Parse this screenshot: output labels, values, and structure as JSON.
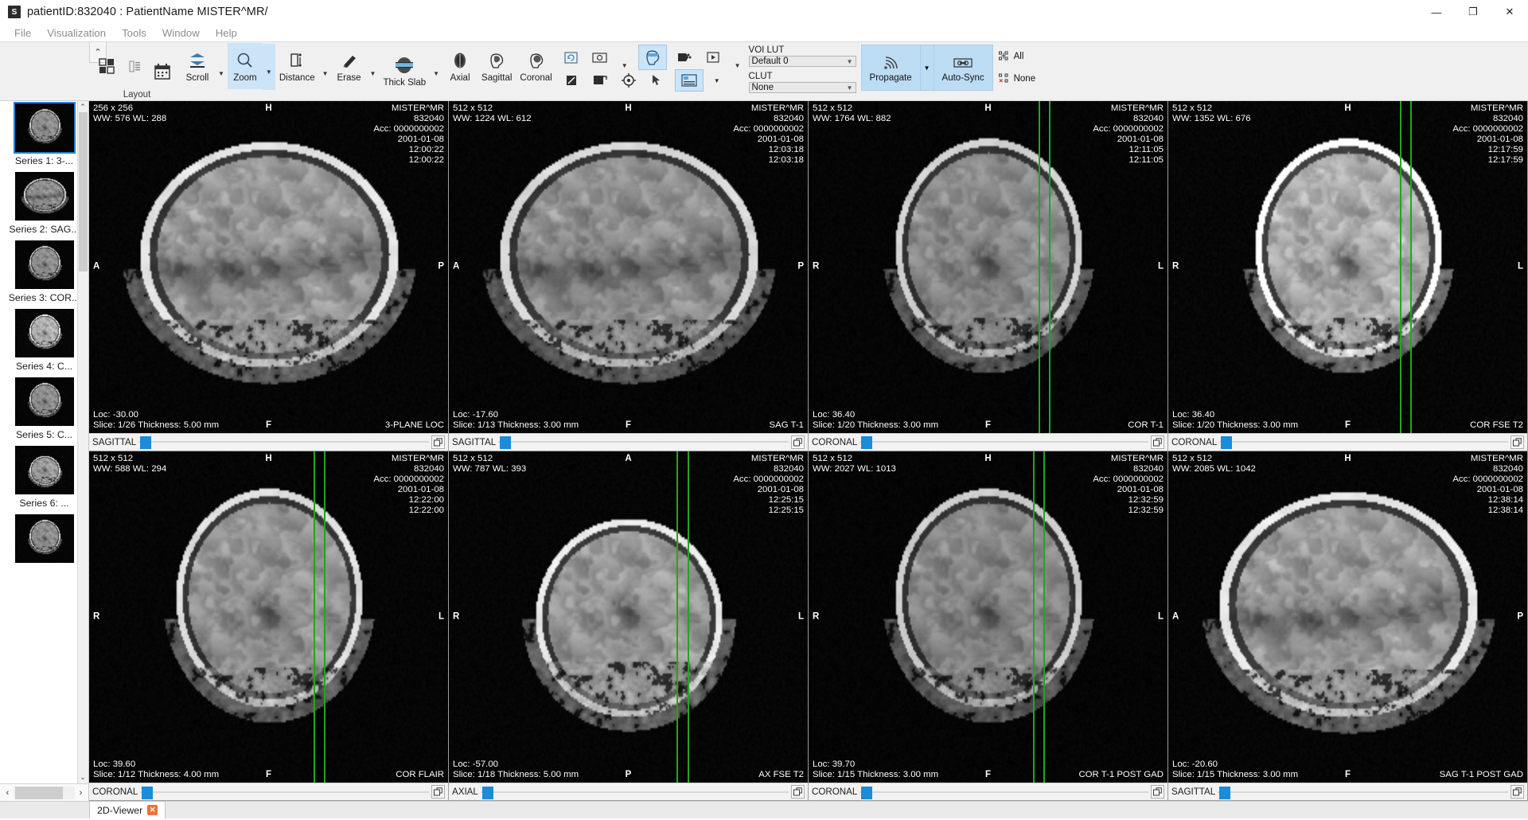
{
  "window": {
    "title": "patientID:832040 : PatientName MISTER^MR/",
    "app_icon": "S",
    "minimize": "—",
    "maximize": "❐",
    "close": "✕"
  },
  "menu": {
    "items": [
      "File",
      "Visualization",
      "Tools",
      "Window",
      "Help"
    ]
  },
  "ribbon": {
    "collapse_icon": "⌃",
    "layout_label": "Layout",
    "buttons": [
      {
        "name": "layout-grid",
        "label": "",
        "icon": "layout-grid-icon"
      },
      {
        "name": "layout-list",
        "label": "",
        "icon": "layout-list-icon"
      },
      {
        "name": "layout-calendar",
        "label": "",
        "icon": "calendar-icon"
      },
      {
        "name": "scroll",
        "label": "Scroll",
        "icon": "scroll-icon"
      },
      {
        "name": "zoom",
        "label": "Zoom",
        "icon": "magnifier-icon",
        "active": true
      },
      {
        "name": "distance",
        "label": "Distance",
        "icon": "distance-icon"
      },
      {
        "name": "erase",
        "label": "Erase",
        "icon": "eraser-icon"
      },
      {
        "name": "thick-slab",
        "label": "Thick Slab",
        "icon": "thick-slab-icon"
      },
      {
        "name": "axial",
        "label": "Axial",
        "icon": "axial-head-icon"
      },
      {
        "name": "sagittal",
        "label": "Sagittal",
        "icon": "sagittal-head-icon"
      },
      {
        "name": "coronal",
        "label": "Coronal",
        "icon": "coronal-head-icon"
      }
    ],
    "voi_lut": {
      "label": "VOI LUT",
      "value": "Default 0"
    },
    "clut": {
      "label": "CLUT",
      "value": "None"
    },
    "propagate": {
      "label": "Propagate",
      "icon": "broadcast-icon"
    },
    "auto_sync": {
      "label": "Auto-Sync",
      "icon": "link-icon"
    },
    "sync_all": {
      "label": "All",
      "icon": "sync-all-icon"
    },
    "sync_none": {
      "label": "None",
      "icon": "sync-none-icon"
    }
  },
  "sidebar": {
    "scroll_up": "⌃",
    "scroll_down": "⌄",
    "left_arrow": "‹",
    "right_arrow": "›",
    "series": [
      {
        "label": "Series 1: 3-...",
        "thumb": "coronal-brain"
      },
      {
        "label": "Series 2: SAG...",
        "thumb": "sagittal-brain"
      },
      {
        "label": "Series 3: COR...",
        "thumb": "coronal-brain"
      },
      {
        "label": "Series 4: C...",
        "thumb": "coronal-bright"
      },
      {
        "label": "Series 5: C...",
        "thumb": "coronal-brain"
      },
      {
        "label": "Series 6: ...",
        "thumb": "axial-skull"
      },
      {
        "label": "",
        "thumb": "coronal-brain"
      }
    ]
  },
  "viewports": [
    {
      "matrix": "256 x 256",
      "window": "WW: 576 WL: 288",
      "patient_name": "MISTER^MR",
      "patient_id": "832040",
      "accession": "Acc: 0000000002",
      "date": "2001-01-08",
      "time1": "12:00:22",
      "time2": "12:00:22",
      "loc": "Loc: -30.00",
      "slice": "Slice: 1/26 Thickness: 5.00 mm",
      "series_desc": "3-PLANE LOC",
      "orient_top": "H",
      "orient_bottom": "F",
      "orient_left": "A",
      "orient_right": "P",
      "bar_orient": "SAGITTAL",
      "slider_pos": 2,
      "reflines": [],
      "render": "sagittal-head"
    },
    {
      "matrix": "512 x 512",
      "window": "WW: 1224 WL: 612",
      "patient_name": "MISTER^MR",
      "patient_id": "832040",
      "accession": "Acc: 0000000002",
      "date": "2001-01-08",
      "time1": "12:03:18",
      "time2": "12:03:18",
      "loc": "Loc: -17.60",
      "slice": "Slice: 1/13 Thickness: 3.00 mm",
      "series_desc": "SAG T-1",
      "orient_top": "H",
      "orient_bottom": "F",
      "orient_left": "A",
      "orient_right": "P",
      "bar_orient": "SAGITTAL",
      "slider_pos": 2,
      "reflines": [],
      "render": "sagittal-head2"
    },
    {
      "matrix": "512 x 512",
      "window": "WW: 1764 WL: 882",
      "patient_name": "MISTER^MR",
      "patient_id": "832040",
      "accession": "Acc: 0000000002",
      "date": "2001-01-08",
      "time1": "12:11:05",
      "time2": "12:11:05",
      "loc": "Loc: 36.40",
      "slice": "Slice: 1/20 Thickness: 3.00 mm",
      "series_desc": "COR T-1",
      "orient_top": "H",
      "orient_bottom": "F",
      "orient_left": "R",
      "orient_right": "L",
      "bar_orient": "CORONAL",
      "slider_pos": 2,
      "reflines": [
        0.64,
        0.67
      ],
      "render": "coronal-head"
    },
    {
      "matrix": "512 x 512",
      "window": "WW: 1352 WL: 676",
      "patient_name": "MISTER^MR",
      "patient_id": "832040",
      "accession": "Acc: 0000000002",
      "date": "2001-01-08",
      "time1": "12:17:59",
      "time2": "12:17:59",
      "loc": "Loc: 36.40",
      "slice": "Slice: 1/20 Thickness: 3.00 mm",
      "series_desc": "COR FSE T2",
      "orient_top": "H",
      "orient_bottom": "F",
      "orient_left": "R",
      "orient_right": "L",
      "bar_orient": "CORONAL",
      "slider_pos": 2,
      "reflines": [
        0.645,
        0.675
      ],
      "render": "coronal-head-bright"
    },
    {
      "matrix": "512 x 512",
      "window": "WW: 588 WL: 294",
      "patient_name": "MISTER^MR",
      "patient_id": "832040",
      "accession": "Acc: 0000000002",
      "date": "2001-01-08",
      "time1": "12:22:00",
      "time2": "12:22:00",
      "loc": "Loc: 39.60",
      "slice": "Slice: 1/12 Thickness: 4.00 mm",
      "series_desc": "COR FLAIR",
      "orient_top": "H",
      "orient_bottom": "F",
      "orient_left": "R",
      "orient_right": "L",
      "bar_orient": "CORONAL",
      "slider_pos": 2,
      "reflines": [
        0.625,
        0.655
      ],
      "render": "coronal-flair"
    },
    {
      "matrix": "512 x 512",
      "window": "WW: 787 WL: 393",
      "patient_name": "MISTER^MR",
      "patient_id": "832040",
      "accession": "Acc: 0000000002",
      "date": "2001-01-08",
      "time1": "12:25:15",
      "time2": "12:25:15",
      "loc": "Loc: -57.00",
      "slice": "Slice: 1/18 Thickness: 5.00 mm",
      "series_desc": "AX FSE T2",
      "orient_top": "A",
      "orient_bottom": "P",
      "orient_left": "R",
      "orient_right": "L",
      "bar_orient": "AXIAL",
      "slider_pos": 2,
      "reflines": [
        0.635,
        0.665
      ],
      "render": "axial-head"
    },
    {
      "matrix": "512 x 512",
      "window": "WW: 2027 WL: 1013",
      "patient_name": "MISTER^MR",
      "patient_id": "832040",
      "accession": "Acc: 0000000002",
      "date": "2001-01-08",
      "time1": "12:32:59",
      "time2": "12:32:59",
      "loc": "Loc: 39.70",
      "slice": "Slice: 1/15 Thickness: 3.00 mm",
      "series_desc": "COR T-1 POST GAD",
      "orient_top": "H",
      "orient_bottom": "F",
      "orient_left": "R",
      "orient_right": "L",
      "bar_orient": "CORONAL",
      "slider_pos": 2,
      "reflines": [
        0.625,
        0.655
      ],
      "render": "coronal-gad"
    },
    {
      "matrix": "512 x 512",
      "window": "WW: 2085 WL: 1042",
      "patient_name": "MISTER^MR",
      "patient_id": "832040",
      "accession": "Acc: 0000000002",
      "date": "2001-01-08",
      "time1": "12:38:14",
      "time2": "12:38:14",
      "loc": "Loc: -20.60",
      "slice": "Slice: 1/15 Thickness: 3.00 mm",
      "series_desc": "SAG T-1 POST GAD",
      "orient_top": "H",
      "orient_bottom": "F",
      "orient_left": "A",
      "orient_right": "P",
      "bar_orient": "SAGITTAL",
      "slider_pos": 2,
      "reflines": [],
      "render": "sagittal-gad"
    }
  ],
  "tabbar": {
    "tab_label": "2D-Viewer",
    "tab_close": "✕"
  },
  "colors": {
    "accent": "#1a8cd8",
    "ribbon_bg": "#f0f0f0",
    "refline": "#1fa71f",
    "sync_bg": "#bcdcf4",
    "tab_close": "#e8743b"
  }
}
